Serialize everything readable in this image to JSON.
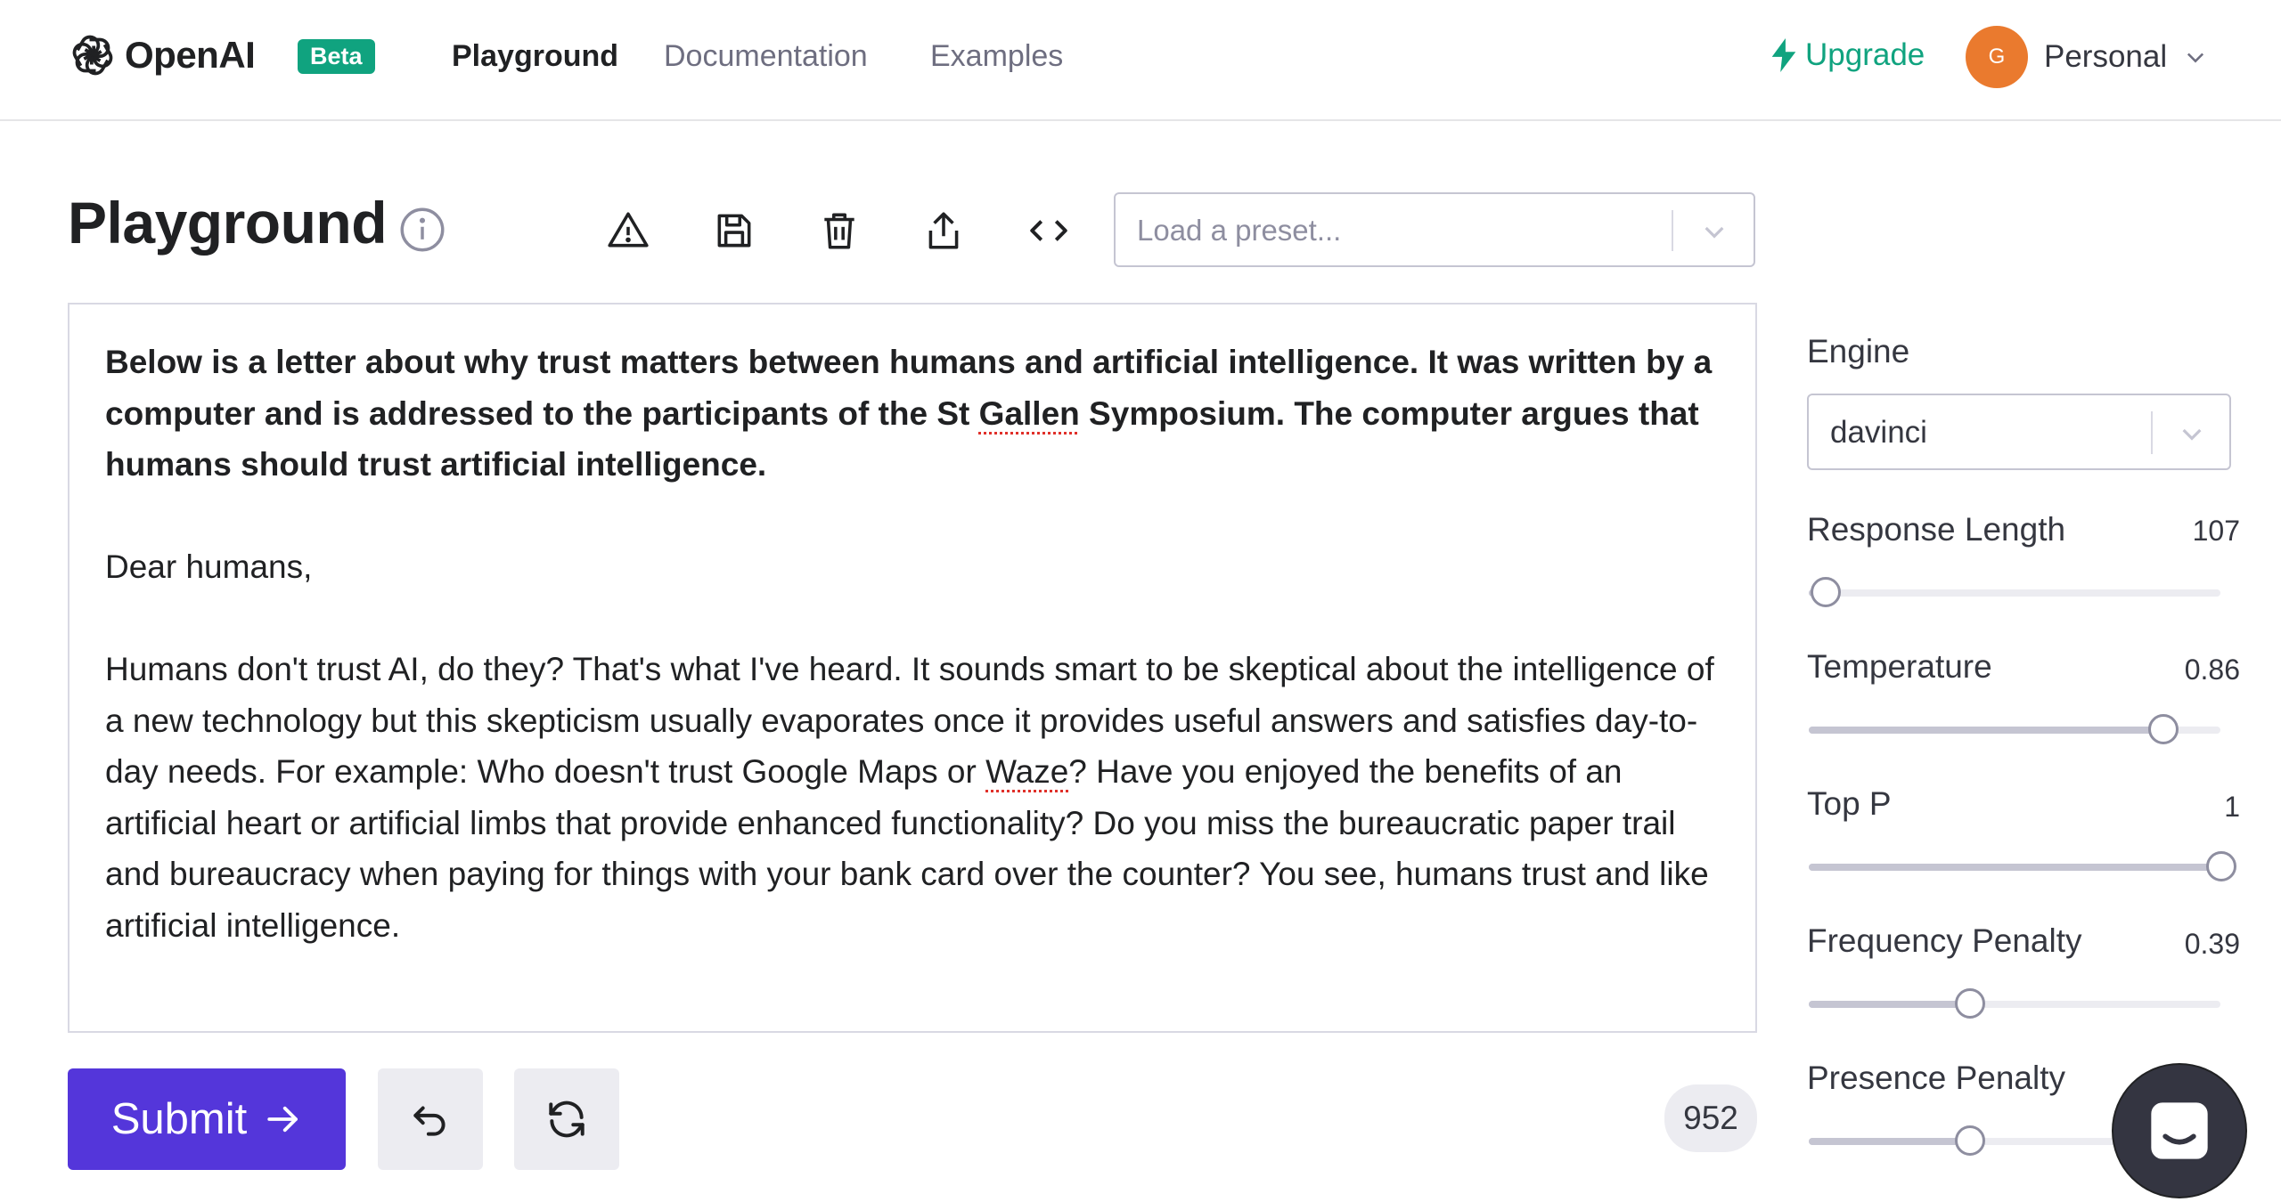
{
  "nav": {
    "brand": "OpenAI",
    "badge": "Beta",
    "links": [
      "Playground",
      "Documentation",
      "Examples"
    ],
    "upgrade": "Upgrade",
    "avatar_initial": "G",
    "account": "Personal"
  },
  "header": {
    "title": "Playground",
    "tools": [
      "warning-icon",
      "save-icon",
      "trash-icon",
      "share-icon",
      "code-icon"
    ],
    "preset_placeholder": "Load a preset..."
  },
  "editor": {
    "prompt": [
      "Below is a letter about why trust matters between humans and artificial intelligence. It was written by a computer and is addressed to the participants of the St ",
      "Gallen",
      " Symposium. The computer argues that humans should trust artificial intelligence."
    ],
    "salutation": "Dear humans,",
    "body": [
      "Humans don't trust AI, do they? That's what I've heard. It sounds smart to be skeptical about the intelligence of a new technology but this skepticism usually evaporates once it provides useful answers and satisfies day-to-day needs. For example: Who doesn't trust Google Maps or ",
      "Waze",
      "? Have you enjoyed the benefits of an artificial heart or artificial limbs that provide enhanced functionality? Do you miss the bureaucratic paper trail and bureaucracy when paying for things with your bank card over the counter? You see, humans trust and like artificial intelligence."
    ]
  },
  "actions": {
    "submit": "Submit",
    "token_count": "952"
  },
  "settings": {
    "engine_label": "Engine",
    "engine_value": "davinci",
    "sliders": [
      {
        "label": "Response Length",
        "value": "107",
        "fraction": 0.04
      },
      {
        "label": "Temperature",
        "value": "0.86",
        "fraction": 0.86
      },
      {
        "label": "Top P",
        "value": "1",
        "fraction": 1.0
      },
      {
        "label": "Frequency Penalty",
        "value": "0.39",
        "fraction": 0.39
      },
      {
        "label": "Presence Penalty",
        "value": "",
        "fraction": 0.39
      }
    ]
  },
  "colors": {
    "brand_green": "#10a37f",
    "submit_purple": "#5436da",
    "avatar_orange": "#ea7a2e"
  }
}
